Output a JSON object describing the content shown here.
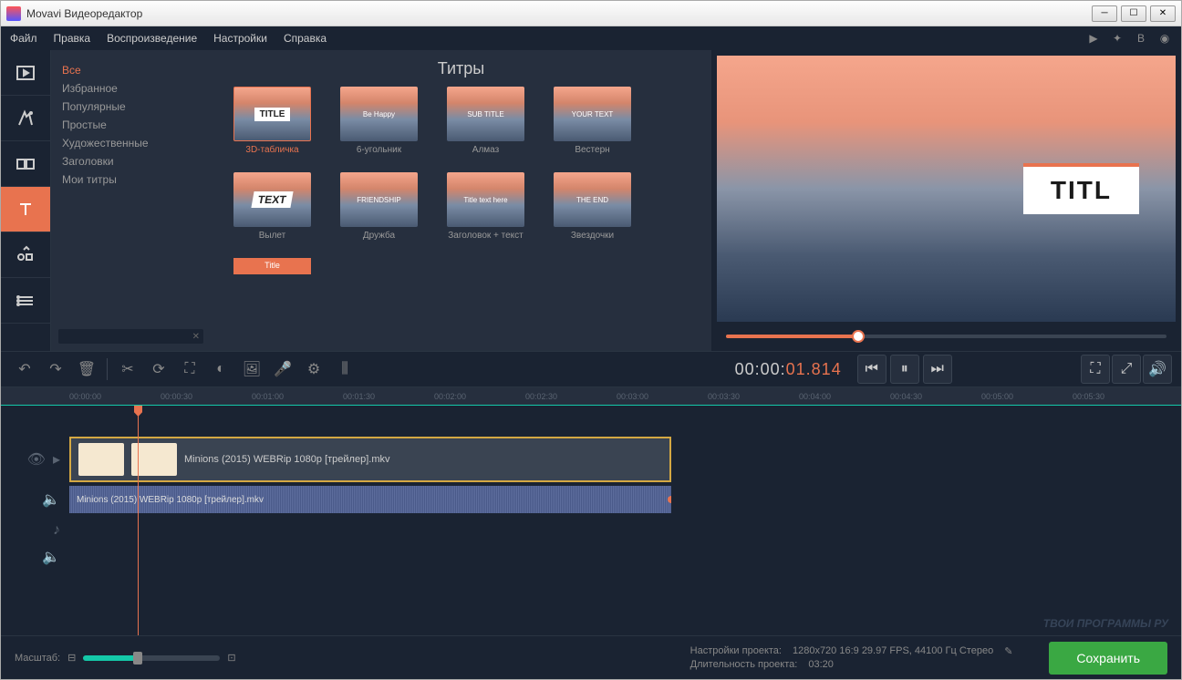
{
  "window": {
    "title": "Movavi Видеоредактор"
  },
  "menu": {
    "file": "Файл",
    "edit": "Правка",
    "playback": "Воспроизведение",
    "settings": "Настройки",
    "help": "Справка"
  },
  "panel": {
    "heading": "Титры"
  },
  "categories": {
    "all": "Все",
    "favorites": "Избранное",
    "popular": "Популярные",
    "simple": "Простые",
    "artistic": "Художественные",
    "headings": "Заголовки",
    "my": "Мои титры"
  },
  "titles": {
    "t1": "3D-табличка",
    "t2": "6-угольник",
    "t3": "Алмаз",
    "t4": "Вестерн",
    "t5": "Вылет",
    "t6": "Дружба",
    "t7": "Заголовок + текст",
    "t8": "Звездочки",
    "t9": "Title"
  },
  "thumbs": {
    "t1": "TITLE",
    "t2": "Be Happy",
    "t3": "SUB TITLE",
    "t4": "YOUR TEXT",
    "t5": "TEXT",
    "t6": "FRIENDSHIP",
    "t7": "Title text here",
    "t8": "THE END"
  },
  "preview": {
    "overlay": "TITL"
  },
  "timecode": {
    "hms": "00:00:",
    "sec": "01",
    "ms": ".814"
  },
  "timeline": {
    "ticks": [
      "00:00:00",
      "00:00:30",
      "00:01:00",
      "00:01:30",
      "00:02:00",
      "00:02:30",
      "00:03:00",
      "00:03:30",
      "00:04:00",
      "00:04:30",
      "00:05:00",
      "00:05:30"
    ],
    "video_clip": "Minions (2015) WEBRip 1080p [трейлер].mkv",
    "audio_clip": "Minions (2015) WEBRip 1080p [трейлер].mkv"
  },
  "bottom": {
    "zoom_label": "Масштаб:",
    "settings_label": "Настройки проекта:",
    "settings_value": "1280x720 16:9 29.97 FPS, 44100 Гц Стерео",
    "duration_label": "Длительность проекта:",
    "duration_value": "03:20",
    "save": "Сохранить",
    "watermark": "ТВОИ ПРОГРАММЫ РУ"
  }
}
